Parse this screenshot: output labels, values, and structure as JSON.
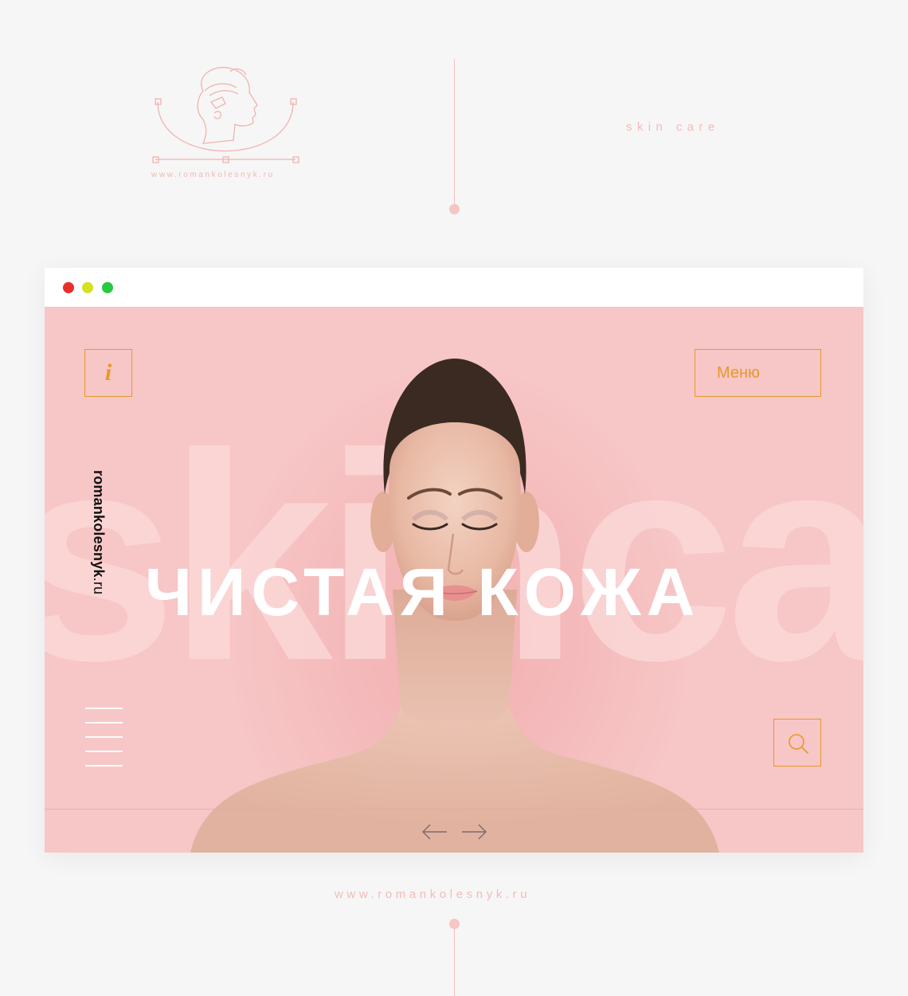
{
  "presentation": {
    "logo_url": "www.romankolesnyk.ru",
    "tagline": "skin care",
    "footer_url": "www.romankolesnyk.ru"
  },
  "browser": {
    "window_controls": [
      "close",
      "minimize",
      "maximize"
    ]
  },
  "hero": {
    "ghost_text": "skincare",
    "headline": "ЧИСТАЯ КОЖА",
    "info_label": "i",
    "menu_label": "Меню",
    "brand_name": "romankolesnyk",
    "brand_tld": ".ru"
  },
  "colors": {
    "accent": "#e8982b",
    "hero_bg": "#f7c6c6",
    "page_bg": "#f6f6f6",
    "soft_pink": "#f2bcb8"
  },
  "icons": {
    "info": "info-icon",
    "search": "search-icon",
    "menu": "hamburger-icon",
    "prev": "arrow-left-icon",
    "next": "arrow-right-icon"
  }
}
